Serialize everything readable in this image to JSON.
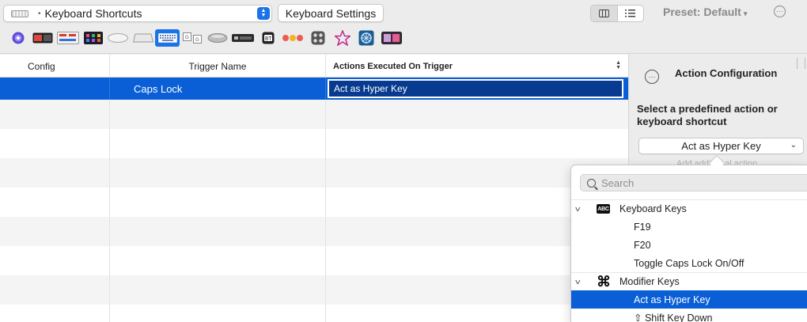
{
  "toolbar": {
    "trigger_type": "Keyboard Shortcuts",
    "keyboard_settings_label": "Keyboard Settings",
    "preset_label": "Preset: Default",
    "preset_caret": "▾",
    "more_glyph": "···"
  },
  "devices": [
    "touch-bar-icon",
    "macbook-touchbar-icon",
    "siri-remote-icon",
    "stream-deck-icon",
    "magic-mouse-icon",
    "magic-trackpad-icon",
    "keyboard-icon",
    "key-sequence-icon",
    "normal-mouse-icon",
    "remote-icon",
    "notch-bar-icon",
    "traffic-lights-icon",
    "automation-icon",
    "other-triggers-icon",
    "bettertouchtool-icon",
    "touchbar-presets-icon"
  ],
  "selected_device": "keyboard-icon",
  "table": {
    "columns": {
      "config": "Config",
      "trigger_name": "Trigger Name",
      "actions": "Actions Executed On Trigger"
    },
    "selected_row": {
      "trigger_name": "Caps Lock",
      "action": "Act as Hyper Key"
    },
    "empty_rows": 7
  },
  "panel": {
    "title": "Action Configuration",
    "description": "Select a predefined action or keyboard shortcut",
    "selected_action": "Act as Hyper Key",
    "add_additional_partial": "Add additional action"
  },
  "popover": {
    "search_placeholder": "Search",
    "groups": [
      {
        "label": "Keyboard Keys",
        "icon": "abc-icon",
        "icon_text": "ABC",
        "items": [
          "F19",
          "F20",
          "Toggle Caps Lock On/Off"
        ]
      },
      {
        "label": "Modifier Keys",
        "icon": "command-icon",
        "icon_text": "⌘",
        "items": [
          "Act as Hyper Key",
          "⇧ Shift Key Down"
        ]
      }
    ],
    "selected_item": "Act as Hyper Key"
  },
  "colors": {
    "accent": "#1a73e8",
    "selection": "#0a5fd7",
    "selected_cell_bg": "#063b8f"
  }
}
